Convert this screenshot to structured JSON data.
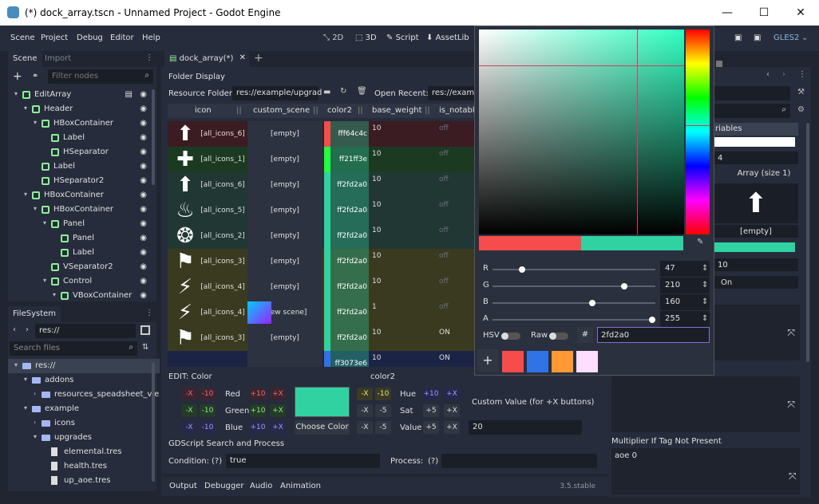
{
  "window": {
    "title": "(*) dock_array.tscn - Unnamed Project - Godot Engine",
    "min": "—",
    "max": "☐",
    "close": "✕"
  },
  "menu": [
    "Scene",
    "Project",
    "Debug",
    "Editor",
    "Help"
  ],
  "workspaces": [
    "2D",
    "3D",
    "Script",
    "AssetLib"
  ],
  "renderer": "GLES2",
  "scene_dock": {
    "tabs": [
      "Scene",
      "Import"
    ],
    "filter_placeholder": "Filter nodes",
    "nodes": [
      {
        "label": "EditArray",
        "icon": "root-control-icon",
        "color": "#8eef97",
        "depth": 0,
        "arrow": "▾"
      },
      {
        "label": "Header",
        "icon": "hbox-icon",
        "color": "#8eef97",
        "depth": 1,
        "arrow": "▾"
      },
      {
        "label": "HBoxContainer",
        "icon": "hbox-icon",
        "color": "#8eef97",
        "depth": 2,
        "arrow": "▾"
      },
      {
        "label": "Label",
        "icon": "label-icon",
        "color": "#8eef97",
        "depth": 3,
        "arrow": ""
      },
      {
        "label": "HSeparator",
        "icon": "hseparator-icon",
        "color": "#8eef97",
        "depth": 3,
        "arrow": ""
      },
      {
        "label": "Label",
        "icon": "label-icon",
        "color": "#8eef97",
        "depth": 2,
        "arrow": ""
      },
      {
        "label": "HSeparator2",
        "icon": "hseparator-icon",
        "color": "#8eef97",
        "depth": 2,
        "arrow": ""
      },
      {
        "label": "HBoxContainer",
        "icon": "hbox-icon",
        "color": "#8eef97",
        "depth": 1,
        "arrow": "▾"
      },
      {
        "label": "HBoxContainer",
        "icon": "hbox-icon",
        "color": "#8eef97",
        "depth": 2,
        "arrow": "▾"
      },
      {
        "label": "Panel",
        "icon": "panel-icon",
        "color": "#8eef97",
        "depth": 3,
        "arrow": "▾"
      },
      {
        "label": "Panel",
        "icon": "panel-icon",
        "color": "#8eef97",
        "depth": 4,
        "arrow": ""
      },
      {
        "label": "Label",
        "icon": "label-icon",
        "color": "#8eef97",
        "depth": 4,
        "arrow": ""
      },
      {
        "label": "VSeparator2",
        "icon": "vseparator-icon",
        "color": "#8eef97",
        "depth": 3,
        "arrow": ""
      },
      {
        "label": "Control",
        "icon": "control-icon",
        "color": "#8eef97",
        "depth": 3,
        "arrow": "▾"
      },
      {
        "label": "VBoxContainer",
        "icon": "vbox-icon",
        "color": "#8eef97",
        "depth": 4,
        "arrow": "▾"
      }
    ]
  },
  "filesystem": {
    "title": "FileSystem",
    "path": "res://",
    "search_placeholder": "Search files",
    "items": [
      {
        "label": "res://",
        "depth": 0,
        "arrow": "▾",
        "type": "folder"
      },
      {
        "label": "addons",
        "depth": 1,
        "arrow": "▾",
        "type": "folder"
      },
      {
        "label": "resources_speadsheet_vie",
        "depth": 2,
        "arrow": "›",
        "type": "folder"
      },
      {
        "label": "example",
        "depth": 1,
        "arrow": "▾",
        "type": "folder"
      },
      {
        "label": "icons",
        "depth": 2,
        "arrow": "›",
        "type": "folder"
      },
      {
        "label": "upgrades",
        "depth": 2,
        "arrow": "▾",
        "type": "folder"
      },
      {
        "label": "elemental.tres",
        "depth": 3,
        "arrow": "",
        "type": "file"
      },
      {
        "label": "health.tres",
        "depth": 3,
        "arrow": "",
        "type": "file"
      },
      {
        "label": "up_aoe.tres",
        "depth": 3,
        "arrow": "",
        "type": "file"
      }
    ]
  },
  "editor_tab": {
    "label": "dock_array(*)",
    "close": "✕",
    "add": "+"
  },
  "folder_display": "Folder Display",
  "resource_folder_label": "Resource Folder:",
  "resource_folder_value": "res://example/upgrad",
  "open_recent_label": "Open Recent:",
  "open_recent_value": "res://example",
  "columns": [
    "icon",
    "custom_scene",
    "color2",
    "base_weight",
    "is_notable"
  ],
  "rows": [
    {
      "icon": "[all_icons_6]",
      "scene": "[empty]",
      "color2": "fff64c4c",
      "weight": "10",
      "notable": "off",
      "rowbg": "#3a1c22",
      "swatch": "#f64c4c",
      "glyph": "⬆"
    },
    {
      "icon": "[all_icons_1]",
      "scene": "[empty]",
      "color2": "ff21ff3e",
      "weight": "10",
      "notable": "off",
      "rowbg": "#1c3a22",
      "swatch": "#21ff3e",
      "glyph": "✚"
    },
    {
      "icon": "[all_icons_6]",
      "scene": "[empty]",
      "color2": "ff2fd2a0",
      "weight": "10",
      "notable": "off",
      "rowbg": "#213733",
      "swatch": "#2fd2a0",
      "glyph": "⬆"
    },
    {
      "icon": "[all_icons_5]",
      "scene": "[empty]",
      "color2": "ff2fd2a0",
      "weight": "10",
      "notable": "off",
      "rowbg": "#213733",
      "swatch": "#2fd2a0",
      "glyph": "♨"
    },
    {
      "icon": "[all_icons_2]",
      "scene": "[empty]",
      "color2": "ff2fd2a0",
      "weight": "10",
      "notable": "off",
      "rowbg": "#213733",
      "swatch": "#2fd2a0",
      "glyph": "❂"
    },
    {
      "icon": "[all_icons_3]",
      "scene": "[empty]",
      "color2": "ff2fd2a0",
      "weight": "10",
      "notable": "off",
      "rowbg": "#3a3a20",
      "swatch": "#2fd2a0",
      "glyph": "⚑"
    },
    {
      "icon": "[all_icons_4]",
      "scene": "[empty]",
      "color2": "ff2fd2a0",
      "weight": "10",
      "notable": "off",
      "rowbg": "#3a3a20",
      "swatch": "#2fd2a0",
      "glyph": "⚡"
    },
    {
      "icon": "[all_icons_4]",
      "scene": "[new scene]",
      "color2": "ff2fd2a0",
      "weight": "1",
      "notable": "off",
      "rowbg": "#3a3a20",
      "swatch": "#2fd2a0",
      "glyph": "⚡"
    },
    {
      "icon": "[all_icons_3]",
      "scene": "[empty]",
      "color2": "ff2fd2a0",
      "weight": "10",
      "notable": "ON",
      "rowbg": "#3a3a20",
      "swatch": "#2fd2a0",
      "glyph": "⚑"
    },
    {
      "icon": "",
      "scene": "",
      "color2": "ff3073e6",
      "weight": "10",
      "notable": "ON",
      "rowbg": "#1c2446",
      "swatch": "#3073e6",
      "glyph": ""
    }
  ],
  "edit": {
    "title": "EDIT: Color",
    "field": "color2",
    "labels": [
      "Red",
      "Green",
      "Blue"
    ],
    "right_labels": [
      "Hue",
      "Sat",
      "Value"
    ],
    "minus_x": "-X",
    "minus_10": "-10",
    "minus_5": "-5",
    "plus_10": "+10",
    "plus_5": "+5",
    "plus_x": "+X",
    "choose_color": "Choose Color",
    "custom_value_label": "Custom Value (for +X buttons)",
    "custom_value": "20",
    "swatch": "#2fd2a0"
  },
  "gdscript": {
    "title": "GDScript Search and Process",
    "condition_label": "Condition:",
    "condition_help": "(?)",
    "condition_value": "true",
    "process_label": "Process:",
    "process_help": "(?)",
    "process_value": ""
  },
  "bottom": {
    "tabs": [
      "Output",
      "Debugger",
      "Audio",
      "Animation"
    ],
    "version": "3.5.stable"
  },
  "picker": {
    "r": 47,
    "g": 210,
    "b": 160,
    "a": 255,
    "hsv_label": "HSV",
    "raw_label": "Raw",
    "hash": "#",
    "hex": "2fd2a0",
    "old_color": "#f64c4c",
    "new_color": "#2fd2a0",
    "presets": [
      "#f64c4c",
      "#3073e6",
      "#ff9933",
      "#ffddff"
    ],
    "add": "+",
    "channel_labels": [
      "R",
      "G",
      "B",
      "A"
    ]
  },
  "inspector": {
    "section": "riables",
    "value1": "4",
    "array": "Array (size 1)",
    "empty": "[empty]",
    "num": "10",
    "on": "On",
    "multiplier_label": "Multiplier If Tag Not Present",
    "multiplier_value": "aoe 0"
  }
}
